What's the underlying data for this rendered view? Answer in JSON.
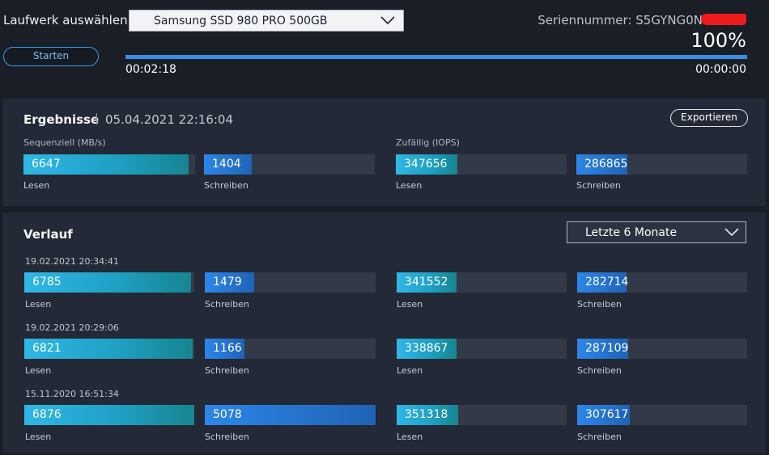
{
  "header": {
    "drive_label": "Laufwerk auswählen",
    "drive_selected": "Samsung SSD 980 PRO 500GB",
    "serial_label": "Seriennummer:",
    "serial_value": "S5GYNG0N",
    "percent": "100%",
    "start_button": "Starten",
    "progress_fraction": 1.0,
    "elapsed": "00:02:18",
    "remaining": "00:00:00"
  },
  "results": {
    "title": "Ergebnisse",
    "separator": "|",
    "timestamp": "05.04.2021 22:16:04",
    "export_button": "Exportieren",
    "sequential_label": "Sequenziell (MB/s)",
    "random_label": "Zufällig (IOPS)",
    "bars": [
      {
        "value": "6647",
        "label": "Lesen",
        "fraction": 0.96,
        "color": "cyan"
      },
      {
        "value": "1404",
        "label": "Schreiben",
        "fraction": 0.28,
        "color": "blue"
      },
      {
        "value": "347656",
        "label": "Lesen",
        "fraction": 0.36,
        "color": "cyan"
      },
      {
        "value": "286865",
        "label": "Schreiben",
        "fraction": 0.3,
        "color": "blue"
      }
    ]
  },
  "history": {
    "title": "Verlauf",
    "range_selected": "Letzte 6 Monate",
    "runs": [
      {
        "timestamp": "19.02.2021 20:34:41",
        "bars": [
          {
            "value": "6785",
            "label": "Lesen",
            "fraction": 0.98,
            "color": "cyan"
          },
          {
            "value": "1479",
            "label": "Schreiben",
            "fraction": 0.29,
            "color": "blue"
          },
          {
            "value": "341552",
            "label": "Lesen",
            "fraction": 0.35,
            "color": "cyan"
          },
          {
            "value": "282714",
            "label": "Schreiben",
            "fraction": 0.29,
            "color": "blue"
          }
        ]
      },
      {
        "timestamp": "19.02.2021 20:29:06",
        "bars": [
          {
            "value": "6821",
            "label": "Lesen",
            "fraction": 0.99,
            "color": "cyan"
          },
          {
            "value": "1166",
            "label": "Schreiben",
            "fraction": 0.23,
            "color": "blue"
          },
          {
            "value": "338867",
            "label": "Lesen",
            "fraction": 0.35,
            "color": "cyan"
          },
          {
            "value": "287109",
            "label": "Schreiben",
            "fraction": 0.3,
            "color": "blue"
          }
        ]
      },
      {
        "timestamp": "15.11.2020 16:51:34",
        "bars": [
          {
            "value": "6876",
            "label": "Lesen",
            "fraction": 1.0,
            "color": "cyan"
          },
          {
            "value": "5078",
            "label": "Schreiben",
            "fraction": 1.0,
            "color": "blue"
          },
          {
            "value": "351318",
            "label": "Lesen",
            "fraction": 0.36,
            "color": "cyan"
          },
          {
            "value": "307617",
            "label": "Schreiben",
            "fraction": 0.31,
            "color": "blue"
          }
        ]
      }
    ]
  },
  "icons": {
    "drive_dropdown": "chevron-down-icon",
    "range_dropdown": "chevron-down-icon"
  },
  "colors": {
    "background": "#1a1e27",
    "panel": "#232936",
    "accent_blue": "#3a8fe5",
    "cyan_bar": "#1fa0c4",
    "blue_bar": "#1f63b6",
    "redaction": "#ee1c1c"
  }
}
